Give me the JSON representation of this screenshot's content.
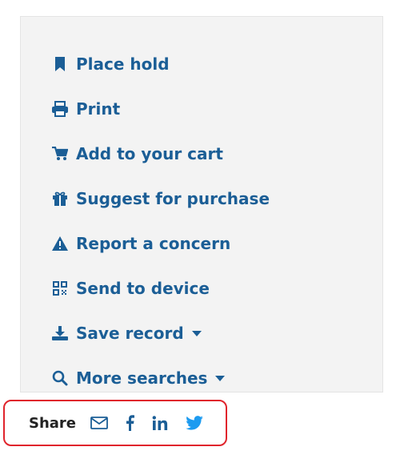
{
  "actions": [
    {
      "label": "Place hold",
      "icon": "bookmark-icon",
      "dropdown": false
    },
    {
      "label": "Print",
      "icon": "print-icon",
      "dropdown": false
    },
    {
      "label": "Add to your cart",
      "icon": "cart-icon",
      "dropdown": false
    },
    {
      "label": "Suggest for purchase",
      "icon": "gift-icon",
      "dropdown": false
    },
    {
      "label": "Report a concern",
      "icon": "warning-icon",
      "dropdown": false
    },
    {
      "label": "Send to device",
      "icon": "qr-code-icon",
      "dropdown": false
    },
    {
      "label": "Save record",
      "icon": "download-icon",
      "dropdown": true
    },
    {
      "label": "More searches",
      "icon": "search-icon",
      "dropdown": true
    }
  ],
  "share": {
    "label": "Share",
    "icons": [
      "email-icon",
      "facebook-icon",
      "linkedin-icon",
      "twitter-icon"
    ]
  },
  "colors": {
    "link": "#1b5e96",
    "panel_bg": "#f3f3f3",
    "highlight_border": "#e0242c",
    "twitter": "#1d9bf0"
  }
}
